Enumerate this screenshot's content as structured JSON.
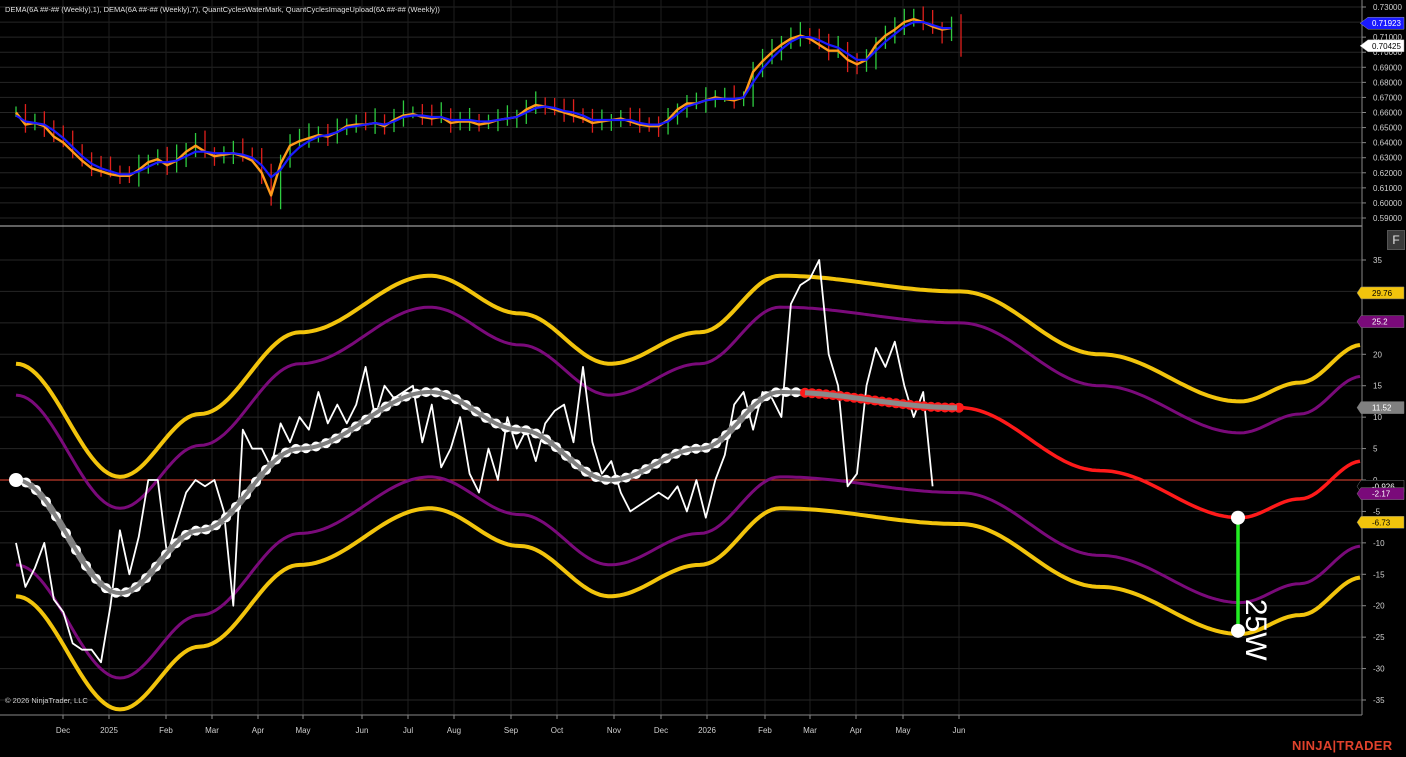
{
  "title": "DEMA(6A ##-## (Weekly),1), DEMA(6A ##-## (Weekly),7), QuantCyclesWaterMark, QuantCyclesImageUpload(6A ##-## (Weekly))",
  "copyright": "© 2026 NinjaTrader, LLC",
  "logo": "NINJATRADER",
  "f_button": "F",
  "cycle_label": "25W",
  "colors": {
    "background": "#000000",
    "bull_bar": "#2ecc40",
    "bear_bar": "#e0201c",
    "dema1": "#ff9a1a",
    "dema7": "#1a1aff",
    "outer_band": "#f2c40c",
    "inner_band": "#7a0a7a",
    "cycle_past": "#808080",
    "cycle_projection": "#ff1a1a",
    "oscillator": "#ffffff",
    "zero_line": "#c0392b",
    "cycle_marker": "#22ee22"
  },
  "chart_data": [
    {
      "type": "line",
      "name": "price-panel",
      "ylim": [
        0.585,
        0.735
      ],
      "y_ticks": [
        "0.73000",
        "0.72000",
        "0.71000",
        "0.70000",
        "0.69000",
        "0.68000",
        "0.67000",
        "0.66000",
        "0.65000",
        "0.64000",
        "0.63000",
        "0.62000",
        "0.61000",
        "0.60000",
        "0.59000"
      ],
      "price_badges": [
        {
          "value": 0.71923,
          "text": "0.71923",
          "bg": "#1a1aff",
          "fg": "#ffffff"
        },
        {
          "value": 0.70425,
          "text": "0.70425",
          "bg": "#ffffff",
          "fg": "#000000"
        }
      ],
      "closes": [
        0.66,
        0.652,
        0.652,
        0.65,
        0.645,
        0.64,
        0.635,
        0.628,
        0.624,
        0.622,
        0.62,
        0.618,
        0.617,
        0.624,
        0.628,
        0.63,
        0.624,
        0.63,
        0.635,
        0.64,
        0.633,
        0.63,
        0.632,
        0.634,
        0.632,
        0.63,
        0.618,
        0.602,
        0.628,
        0.64,
        0.642,
        0.644,
        0.646,
        0.644,
        0.648,
        0.652,
        0.653,
        0.652,
        0.654,
        0.65,
        0.656,
        0.66,
        0.66,
        0.658,
        0.656,
        0.658,
        0.652,
        0.654,
        0.655,
        0.652,
        0.653,
        0.655,
        0.656,
        0.657,
        0.662,
        0.666,
        0.664,
        0.662,
        0.66,
        0.658,
        0.656,
        0.652,
        0.654,
        0.655,
        0.656,
        0.654,
        0.652,
        0.651,
        0.65,
        0.655,
        0.662,
        0.666,
        0.666,
        0.668,
        0.67,
        0.67,
        0.668,
        0.67,
        0.688,
        0.695,
        0.7,
        0.706,
        0.71,
        0.712,
        0.71,
        0.705,
        0.7,
        0.702,
        0.693,
        0.69,
        0.694,
        0.706,
        0.712,
        0.716,
        0.72,
        0.724,
        0.72,
        0.716,
        0.712,
        0.718,
        0.7
      ],
      "dema1": [
        0.66,
        0.652,
        0.653,
        0.651,
        0.644,
        0.64,
        0.634,
        0.628,
        0.623,
        0.621,
        0.619,
        0.618,
        0.618,
        0.622,
        0.627,
        0.629,
        0.625,
        0.628,
        0.634,
        0.638,
        0.634,
        0.631,
        0.632,
        0.633,
        0.631,
        0.628,
        0.62,
        0.605,
        0.626,
        0.638,
        0.641,
        0.643,
        0.645,
        0.644,
        0.647,
        0.651,
        0.652,
        0.652,
        0.653,
        0.651,
        0.655,
        0.658,
        0.659,
        0.657,
        0.656,
        0.657,
        0.653,
        0.654,
        0.654,
        0.652,
        0.653,
        0.655,
        0.656,
        0.657,
        0.662,
        0.665,
        0.664,
        0.662,
        0.66,
        0.658,
        0.656,
        0.653,
        0.654,
        0.655,
        0.656,
        0.654,
        0.652,
        0.651,
        0.651,
        0.655,
        0.662,
        0.666,
        0.666,
        0.668,
        0.67,
        0.669,
        0.668,
        0.67,
        0.687,
        0.694,
        0.7,
        0.705,
        0.709,
        0.711,
        0.709,
        0.705,
        0.701,
        0.701,
        0.695,
        0.692,
        0.695,
        0.705,
        0.711,
        0.715,
        0.72,
        0.722,
        0.72,
        0.717,
        0.715,
        0.716
      ],
      "dema7": [
        0.658,
        0.654,
        0.653,
        0.652,
        0.648,
        0.643,
        0.637,
        0.631,
        0.626,
        0.623,
        0.621,
        0.619,
        0.619,
        0.621,
        0.624,
        0.627,
        0.627,
        0.628,
        0.631,
        0.634,
        0.634,
        0.633,
        0.633,
        0.633,
        0.632,
        0.63,
        0.625,
        0.617,
        0.622,
        0.631,
        0.637,
        0.641,
        0.644,
        0.645,
        0.647,
        0.65,
        0.651,
        0.652,
        0.653,
        0.652,
        0.654,
        0.657,
        0.658,
        0.658,
        0.657,
        0.657,
        0.655,
        0.655,
        0.655,
        0.654,
        0.654,
        0.655,
        0.656,
        0.657,
        0.66,
        0.663,
        0.664,
        0.663,
        0.661,
        0.66,
        0.658,
        0.655,
        0.655,
        0.655,
        0.655,
        0.655,
        0.653,
        0.652,
        0.652,
        0.654,
        0.659,
        0.664,
        0.666,
        0.668,
        0.669,
        0.669,
        0.669,
        0.67,
        0.68,
        0.689,
        0.696,
        0.702,
        0.707,
        0.71,
        0.71,
        0.708,
        0.705,
        0.703,
        0.699,
        0.695,
        0.695,
        0.701,
        0.707,
        0.712,
        0.717,
        0.72,
        0.72,
        0.718,
        0.716,
        0.716
      ]
    },
    {
      "type": "line",
      "name": "cycle-panel",
      "ylim": [
        -37,
        38
      ],
      "y_ticks": [
        "35",
        "30",
        "25",
        "20",
        "15",
        "10",
        "5",
        "0",
        "-5",
        "-10",
        "-15",
        "-20",
        "-25",
        "-30",
        "-35"
      ],
      "value_badges": [
        {
          "value": 29.76,
          "text": "29.76",
          "bg": "#f2c40c",
          "fg": "#000000"
        },
        {
          "value": 25.2,
          "text": "25.2",
          "bg": "#7a0a7a",
          "fg": "#ffffff"
        },
        {
          "value": 11.52,
          "text": "11.52",
          "bg": "#808080",
          "fg": "#ffffff"
        },
        {
          "value": 0,
          "text": "-0.926",
          "bg": "#000000",
          "fg": "#ffffff"
        },
        {
          "value": -2.17,
          "text": "-2.17",
          "bg": "#7a0a7a",
          "fg": "#ffffff"
        },
        {
          "value": -6.73,
          "text": "-6.73",
          "bg": "#f2c40c",
          "fg": "#000000"
        }
      ],
      "oscillator": [
        -10,
        -17,
        -14,
        -10,
        -19,
        -21,
        -26,
        -27,
        -27,
        -29,
        -20,
        -8,
        -15,
        -9,
        0,
        0,
        -12,
        -7,
        -2,
        0,
        -1,
        0,
        -5,
        -20,
        8,
        5,
        5,
        2,
        9,
        6,
        10,
        8,
        14,
        9,
        12,
        9,
        12,
        18,
        10,
        15,
        13,
        14,
        15,
        6,
        12,
        2,
        5,
        10,
        1,
        -2,
        5,
        0,
        10,
        5,
        8,
        3,
        9,
        11,
        12,
        6,
        18,
        6,
        1,
        3,
        -2,
        -5,
        -4,
        -3,
        -2,
        -3,
        -1,
        -5,
        0,
        -6,
        0,
        4,
        12,
        14,
        8,
        14,
        13,
        10,
        28,
        31,
        32,
        35,
        20,
        15,
        -1,
        1,
        15,
        21,
        18,
        22,
        15,
        10,
        14,
        -1
      ],
      "cycle_past_x": [
        -50,
        -45,
        -40,
        -35,
        -30,
        -25,
        -20,
        -15,
        -10,
        -5,
        0,
        5,
        10,
        15,
        20,
        25,
        30,
        35,
        40,
        45,
        50,
        55,
        60,
        65,
        70,
        75,
        80,
        85,
        90,
        95,
        100,
        105,
        110,
        115,
        120,
        125,
        130,
        135,
        140,
        145,
        150,
        155,
        160,
        165,
        170,
        175,
        180,
        185,
        190,
        195,
        200,
        205,
        210,
        215,
        220,
        225,
        230,
        235,
        240,
        245,
        250,
        255,
        260,
        265,
        270,
        275,
        280,
        285,
        290,
        295,
        300,
        305,
        310,
        315,
        320,
        325,
        330,
        335,
        340,
        345,
        350,
        355,
        360,
        365,
        370,
        375,
        380,
        385,
        390,
        395,
        400,
        405,
        410,
        415,
        420,
        425,
        430,
        435,
        440,
        445,
        450
      ]
    }
  ],
  "x_axis": {
    "ticks": [
      "Dec",
      "2025",
      "Feb",
      "Mar",
      "Apr",
      "May",
      "Jun",
      "Jul",
      "Aug",
      "Sep",
      "Oct",
      "Nov",
      "Dec",
      "2026",
      "Feb",
      "Mar",
      "Apr",
      "May",
      "Jun"
    ]
  }
}
